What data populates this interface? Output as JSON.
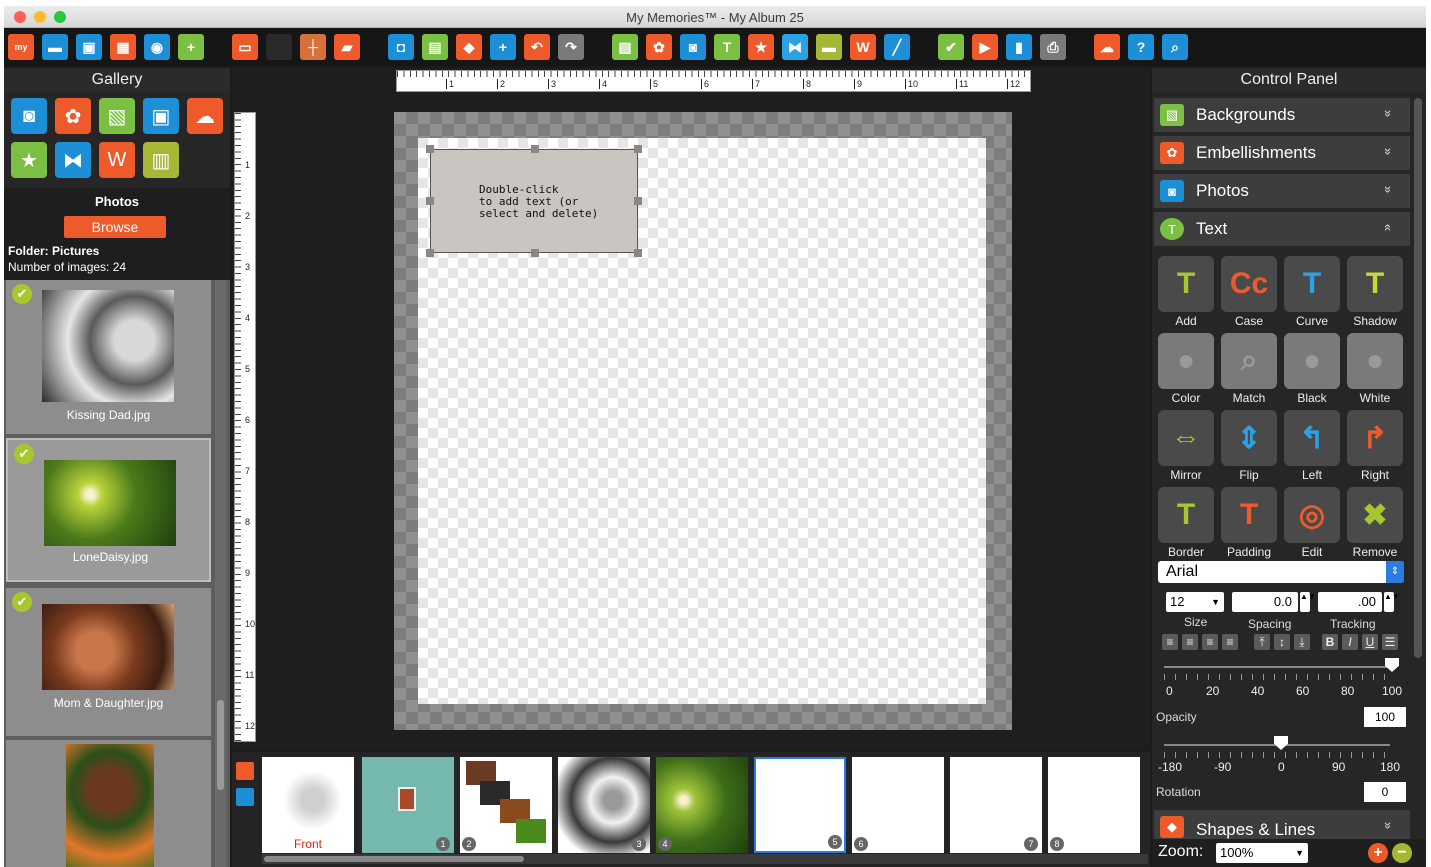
{
  "window": {
    "title": "My Memories™ - My Album 25"
  },
  "toolbar": {
    "items": [
      {
        "icon": "my-logo-icon",
        "glyph": "my",
        "color": "#ef5a2a"
      },
      {
        "icon": "folder-icon",
        "glyph": "▬",
        "color": "#1d8fd6"
      },
      {
        "icon": "save-icon",
        "glyph": "▣",
        "color": "#1d8fd6"
      },
      {
        "icon": "layout-icon",
        "glyph": "▦",
        "color": "#ef5a2a"
      },
      {
        "icon": "export-icon",
        "glyph": "◉",
        "color": "#1d8fd6"
      },
      {
        "icon": "add-page-icon",
        "glyph": "+",
        "color": "#7bc043"
      },
      {
        "icon": "frame-icon",
        "glyph": "▭",
        "color": "#ef5a2a"
      },
      {
        "icon": "blank-icon",
        "glyph": "",
        "color": "#2a2a2a"
      },
      {
        "icon": "crosshair-icon",
        "glyph": "┼",
        "color": "#d8703c"
      },
      {
        "icon": "pages-icon",
        "glyph": "▰",
        "color": "#ef5a2a"
      },
      {
        "icon": "gift-icon",
        "glyph": "◘",
        "color": "#1d8fd6"
      },
      {
        "icon": "print-page-icon",
        "glyph": "▤",
        "color": "#7bc043"
      },
      {
        "icon": "stamp-icon",
        "glyph": "◆",
        "color": "#ef5a2a"
      },
      {
        "icon": "add-photo-icon",
        "glyph": "+",
        "color": "#1d8fd6"
      },
      {
        "icon": "undo-icon",
        "glyph": "↶",
        "color": "#ef5a2a"
      },
      {
        "icon": "redo-icon",
        "glyph": "↷",
        "color": "#7a7a7a"
      },
      {
        "icon": "picture-icon",
        "glyph": "▧",
        "color": "#7bc043"
      },
      {
        "icon": "flower-icon",
        "glyph": "✿",
        "color": "#ef5a2a"
      },
      {
        "icon": "camera-icon",
        "glyph": "◙",
        "color": "#1d8fd6"
      },
      {
        "icon": "text-tool-icon",
        "glyph": "T",
        "color": "#7bc043"
      },
      {
        "icon": "star-icon",
        "glyph": "★",
        "color": "#ef5a2a"
      },
      {
        "icon": "butterfly-icon",
        "glyph": "⧓",
        "color": "#2aa3e6"
      },
      {
        "icon": "ribbon-icon",
        "glyph": "▬",
        "color": "#a6b736"
      },
      {
        "icon": "wordart-icon",
        "glyph": "W",
        "color": "#ef5a2a"
      },
      {
        "icon": "pen-icon",
        "glyph": "╱",
        "color": "#1d8fd6"
      },
      {
        "icon": "check-icon",
        "glyph": "✔",
        "color": "#7bc043"
      },
      {
        "icon": "play-icon",
        "glyph": "▶",
        "color": "#ef5a2a"
      },
      {
        "icon": "book-icon",
        "glyph": "▮",
        "color": "#1d8fd6"
      },
      {
        "icon": "printer-icon",
        "glyph": "⎙",
        "color": "#7a7a7a"
      },
      {
        "icon": "cloud-icon",
        "glyph": "☁",
        "color": "#ef5a2a"
      },
      {
        "icon": "help-icon",
        "glyph": "?",
        "color": "#1d8fd6"
      },
      {
        "icon": "search-icon",
        "glyph": "⌕",
        "color": "#1d8fd6"
      }
    ]
  },
  "gallery": {
    "title": "Gallery",
    "icons": [
      {
        "icon": "camera-icon",
        "glyph": "◙",
        "color": "#1d8fd6"
      },
      {
        "icon": "flower-icon",
        "glyph": "✿",
        "color": "#ef5a2a"
      },
      {
        "icon": "picture-icon",
        "glyph": "▧",
        "color": "#7bc043"
      },
      {
        "icon": "frames-icon",
        "glyph": "▣",
        "color": "#1d8fd6"
      },
      {
        "icon": "cloud-icon",
        "glyph": "☁",
        "color": "#ef5a2a"
      },
      {
        "icon": "star-icon",
        "glyph": "★",
        "color": "#7bc043"
      },
      {
        "icon": "butterfly-icon",
        "glyph": "⧓",
        "color": "#1d8fd6"
      },
      {
        "icon": "wordart-icon",
        "glyph": "W",
        "color": "#ef5a2a"
      },
      {
        "icon": "layout-icon",
        "glyph": "▥",
        "color": "#a6b736"
      }
    ],
    "photos_title": "Photos",
    "browse_label": "Browse",
    "folder_label": "Folder: Pictures",
    "count_label": "Number of images: 24",
    "thumbs": [
      {
        "caption": "Kissing Dad.jpg"
      },
      {
        "caption": "LoneDaisy.jpg"
      },
      {
        "caption": "Mom & Daughter.jpg"
      },
      {
        "caption": ""
      }
    ]
  },
  "ruler": {
    "h_labels": [
      "1",
      "2",
      "3",
      "4",
      "5",
      "6",
      "7",
      "8",
      "9",
      "10",
      "11",
      "12"
    ],
    "v_labels": [
      "1",
      "2",
      "3",
      "4",
      "5",
      "6",
      "7",
      "8",
      "9",
      "10",
      "11",
      "12"
    ]
  },
  "canvas": {
    "textbox_text": "Double-click\nto add text (or\nselect and delete)"
  },
  "filmstrip": {
    "front_label": "Front",
    "page_numbers": [
      "1",
      "2",
      "3",
      "4",
      "5",
      "6",
      "7",
      "8"
    ]
  },
  "control_panel": {
    "title": "Control Panel",
    "sections": [
      {
        "label": "Backgrounds",
        "icon": "picture-icon",
        "chevron": "»",
        "color": "#7bc043"
      },
      {
        "label": "Embellishments",
        "icon": "flower-icon",
        "chevron": "»",
        "color": "#ef5a2a"
      },
      {
        "label": "Photos",
        "icon": "camera-icon",
        "chevron": "»",
        "color": "#1d8fd6"
      },
      {
        "label": "Text",
        "icon": "text-tool-icon",
        "chevron": "«",
        "color": "#7bc043"
      }
    ],
    "text_tools": [
      {
        "label": "Add",
        "icon": "add-text-icon",
        "glyph": "T",
        "color": "#a6c72e"
      },
      {
        "label": "Case",
        "icon": "case-icon",
        "glyph": "Cc",
        "color": "#ef5a2a"
      },
      {
        "label": "Curve",
        "icon": "curve-icon",
        "glyph": "T",
        "color": "#2aa3e6"
      },
      {
        "label": "Shadow",
        "icon": "shadow-icon",
        "glyph": "T",
        "color": "#c8d83a"
      },
      {
        "label": "Color",
        "icon": "color-drop-icon",
        "glyph": "●",
        "color": "#6a6a6a"
      },
      {
        "label": "Match",
        "icon": "match-icon",
        "glyph": "⌕",
        "color": "#6a6a6a"
      },
      {
        "label": "Black",
        "icon": "black-drop-icon",
        "glyph": "●",
        "color": "#6a6a6a"
      },
      {
        "label": "White",
        "icon": "white-drop-icon",
        "glyph": "●",
        "color": "#6a6a6a"
      },
      {
        "label": "Mirror",
        "icon": "mirror-icon",
        "glyph": "⇔",
        "color": "#a6c72e"
      },
      {
        "label": "Flip",
        "icon": "flip-icon",
        "glyph": "⇕",
        "color": "#2aa3e6"
      },
      {
        "label": "Left",
        "icon": "rotate-left-icon",
        "glyph": "↰",
        "color": "#2aa3e6"
      },
      {
        "label": "Right",
        "icon": "rotate-right-icon",
        "glyph": "↱",
        "color": "#ef5a2a"
      },
      {
        "label": "Border",
        "icon": "border-icon",
        "glyph": "T",
        "color": "#a6c72e"
      },
      {
        "label": "Padding",
        "icon": "padding-icon",
        "glyph": "T",
        "color": "#ef5a2a"
      },
      {
        "label": "Edit",
        "icon": "edit-icon",
        "glyph": "◎",
        "color": "#ef5a2a"
      },
      {
        "label": "Remove",
        "icon": "remove-icon",
        "glyph": "✖",
        "color": "#a6c72e"
      }
    ],
    "font": "Arial",
    "size_value": "12",
    "size_label": "Size",
    "spacing_value": "0.0",
    "spacing_label": "Spacing",
    "tracking_value": ".00",
    "tracking_label": "Tracking",
    "opacity": {
      "label": "Opacity",
      "value": "100",
      "ticks": [
        "0",
        "20",
        "40",
        "60",
        "80",
        "100"
      ]
    },
    "rotation": {
      "label": "Rotation",
      "value": "0",
      "ticks": [
        "-180",
        "-90",
        "0",
        "90",
        "180"
      ]
    },
    "shapes_label": "Shapes & Lines",
    "zoom_label": "Zoom:",
    "zoom_value": "100%"
  }
}
